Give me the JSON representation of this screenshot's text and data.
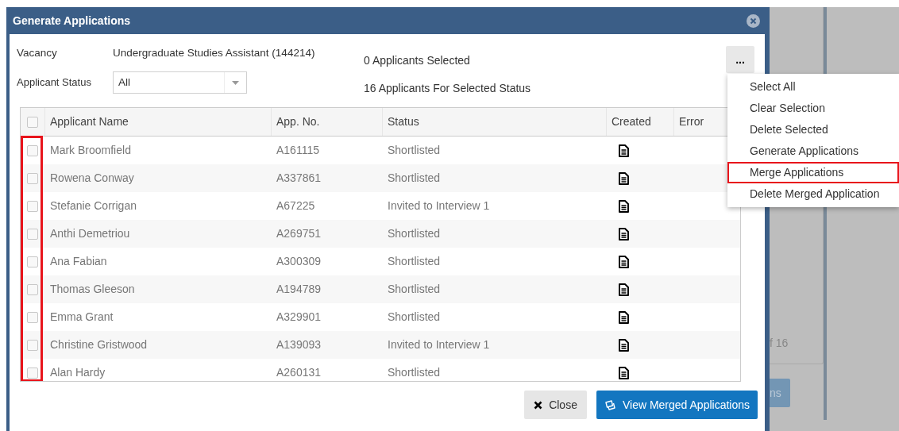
{
  "dialog": {
    "title": "Generate Applications"
  },
  "vacancy": {
    "label": "Vacancy",
    "value": "Undergraduate Studies Assistant (144214)"
  },
  "applicant_status": {
    "label": "Applicant Status",
    "value": "All"
  },
  "counts": [
    "0 Applicants Selected",
    "16 Applicants For Selected Status"
  ],
  "more_button": {
    "label": "..."
  },
  "menu": [
    {
      "label": "Select All",
      "highlighted": false
    },
    {
      "label": "Clear Selection",
      "highlighted": false
    },
    {
      "label": "Delete Selected",
      "highlighted": false
    },
    {
      "label": "Generate Applications",
      "highlighted": false
    },
    {
      "label": "Merge Applications",
      "highlighted": true
    },
    {
      "label": "Delete Merged Application",
      "highlighted": false
    }
  ],
  "table": {
    "header_checked": false,
    "columns": [
      "Applicant Name",
      "App. No.",
      "Status",
      "Created",
      "Error"
    ],
    "checkbox_column_highlighted": true,
    "rows": [
      {
        "checked": false,
        "name": "Mark Broomfield",
        "app_no": "A161115",
        "status": "Shortlisted"
      },
      {
        "checked": false,
        "name": "Rowena Conway",
        "app_no": "A337861",
        "status": "Shortlisted"
      },
      {
        "checked": false,
        "name": "Stefanie Corrigan",
        "app_no": "A67225",
        "status": "Invited to Interview 1"
      },
      {
        "checked": false,
        "name": "Anthi Demetriou",
        "app_no": "A269751",
        "status": "Shortlisted"
      },
      {
        "checked": false,
        "name": "Ana Fabian",
        "app_no": "A300309",
        "status": "Shortlisted"
      },
      {
        "checked": false,
        "name": "Thomas Gleeson",
        "app_no": "A194789",
        "status": "Shortlisted"
      },
      {
        "checked": false,
        "name": "Emma Grant",
        "app_no": "A329901",
        "status": "Shortlisted"
      },
      {
        "checked": false,
        "name": "Christine Gristwood",
        "app_no": "A139093",
        "status": "Invited to Interview 1"
      },
      {
        "checked": false,
        "name": "Alan Hardy",
        "app_no": "A260131",
        "status": "Shortlisted"
      }
    ]
  },
  "buttons": [
    {
      "kind": "close",
      "label": "Close"
    },
    {
      "kind": "primary",
      "label": "View Merged Applications"
    }
  ],
  "background": {
    "pager_text": "f 16",
    "button_text": "ns"
  }
}
